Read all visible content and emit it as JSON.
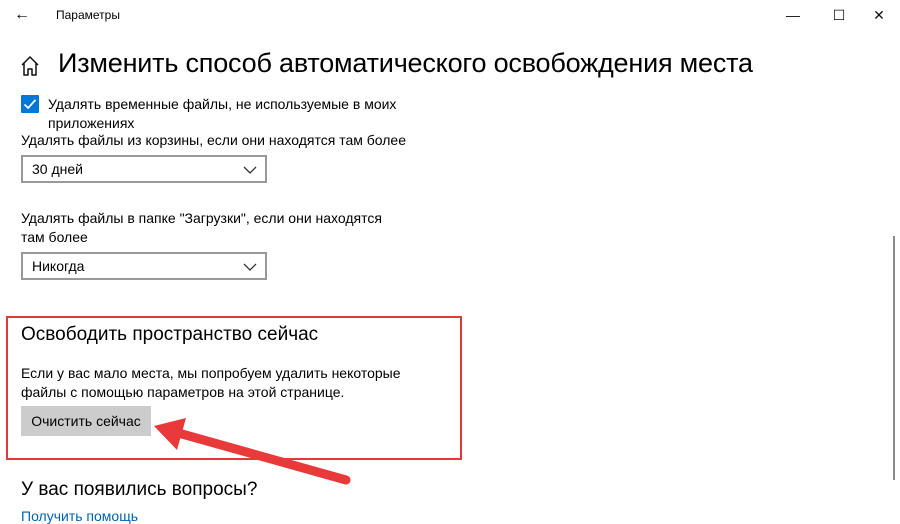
{
  "window": {
    "back_glyph": "←",
    "title": "Параметры",
    "minimize_glyph": "—",
    "maximize_glyph": "☐",
    "close_glyph": "✕"
  },
  "page": {
    "title": "Изменить способ автоматического освобождения места"
  },
  "temp_files": {
    "checked": true,
    "label": "Удалять временные файлы, не используемые в моих приложениях"
  },
  "recycle_bin": {
    "label": "Удалять файлы из корзины, если они находятся там более",
    "selected": "30 дней"
  },
  "downloads": {
    "label": "Удалять файлы в папке \"Загрузки\", если они находятся там более",
    "selected": "Никогда"
  },
  "free_now": {
    "title": "Освободить пространство сейчас",
    "description": "Если у вас мало места, мы попробуем удалить некоторые файлы с помощью параметров на этой странице.",
    "button_label": "Очистить сейчас"
  },
  "questions": {
    "title": "У вас появились вопросы?",
    "help_link": "Получить помощь"
  },
  "colors": {
    "accent": "#0078d7",
    "link": "#0063b1",
    "highlight_border": "#e23a3a",
    "arrow": "#e8393b",
    "button_bg": "#cccccc"
  },
  "icons": {
    "back": "back-arrow-icon",
    "home": "home-icon",
    "dropdown": "chevron-down-icon",
    "check": "check-icon"
  }
}
